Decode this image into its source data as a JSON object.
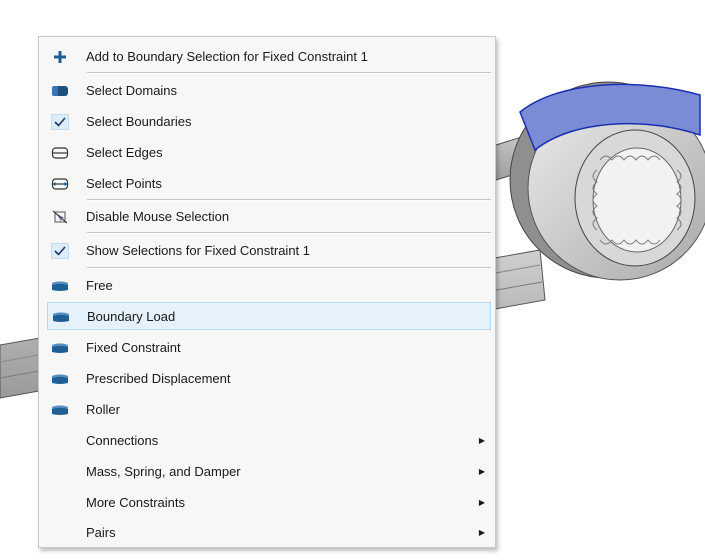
{
  "colors": {
    "menu_bg": "#f7f7f7",
    "icon_blue": "#1f5f96",
    "highlight": "#e5f1fb",
    "selection_blue": "#7b8cd6"
  },
  "menu": {
    "add_to_selection": {
      "label": "Add to Boundary Selection for Fixed Constraint 1",
      "icon": "plus-icon"
    },
    "select_domains": {
      "label": "Select Domains",
      "icon": "select-domains-icon"
    },
    "select_boundaries": {
      "label": "Select Boundaries",
      "icon": "check-icon",
      "checked": true
    },
    "select_edges": {
      "label": "Select Edges",
      "icon": "select-edges-icon"
    },
    "select_points": {
      "label": "Select Points",
      "icon": "select-points-icon"
    },
    "disable_mouse": {
      "label": "Disable Mouse Selection",
      "icon": "disable-selection-icon"
    },
    "show_selections": {
      "label": "Show Selections for Fixed Constraint 1",
      "icon": "check-icon",
      "checked": true
    },
    "free": {
      "label": "Free",
      "icon": "boundary-feature-icon"
    },
    "boundary_load": {
      "label": "Boundary Load",
      "icon": "boundary-feature-icon",
      "highlighted": true
    },
    "fixed_constraint": {
      "label": "Fixed Constraint",
      "icon": "boundary-feature-icon"
    },
    "prescribed_displacement": {
      "label": "Prescribed Displacement",
      "icon": "boundary-feature-icon"
    },
    "roller": {
      "label": "Roller",
      "icon": "boundary-feature-icon"
    },
    "connections": {
      "label": "Connections",
      "submenu": true
    },
    "mass_spring_damper": {
      "label": "Mass, Spring, and Damper",
      "submenu": true
    },
    "more_constraints": {
      "label": "More Constraints",
      "submenu": true
    },
    "pairs": {
      "label": "Pairs",
      "submenu": true
    }
  },
  "submenu_arrow": "▶"
}
